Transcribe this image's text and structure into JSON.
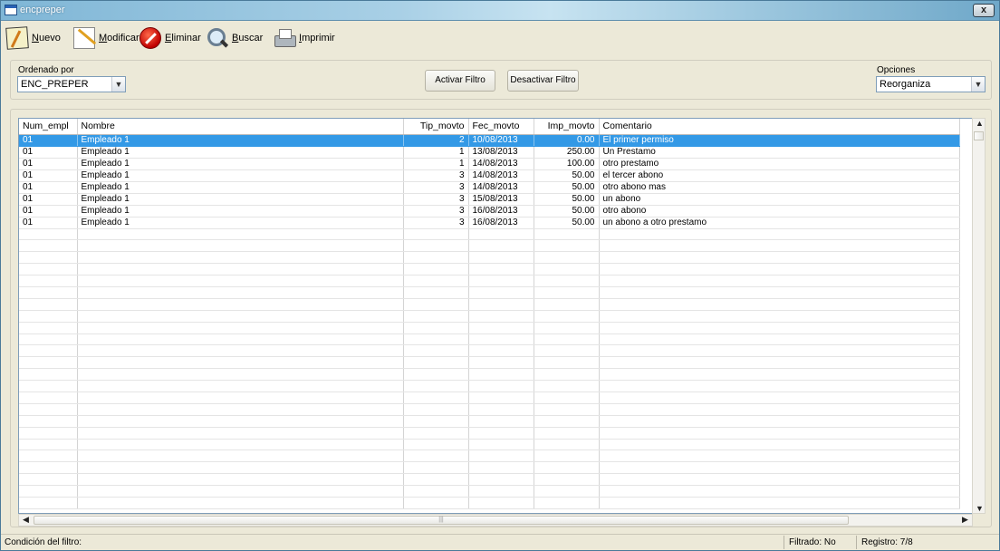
{
  "window": {
    "title": "encpreper",
    "close_label": "x"
  },
  "toolbar": {
    "new_label": "Nuevo",
    "edit_label": "Modificar",
    "delete_label": "Eliminar",
    "search_label": "Buscar",
    "print_label": "Imprimir"
  },
  "filter": {
    "order_label": "Ordenado por",
    "order_value": "ENC_PREPER",
    "activate_label": "Activar Filtro",
    "deactivate_label": "Desactivar Filtro",
    "options_label": "Opciones",
    "options_value": "Reorganiza"
  },
  "grid": {
    "columns": [
      "Num_empl",
      "Nombre",
      "Tip_movto",
      "Fec_movto",
      "Imp_movto",
      "Comentario"
    ],
    "rows": [
      [
        "01",
        "Empleado 1",
        "2",
        "10/08/2013",
        "0.00",
        "El primer permiso"
      ],
      [
        "01",
        "Empleado 1",
        "1",
        "13/08/2013",
        "250.00",
        "Un Prestamo"
      ],
      [
        "01",
        "Empleado 1",
        "1",
        "14/08/2013",
        "100.00",
        "otro prestamo"
      ],
      [
        "01",
        "Empleado 1",
        "3",
        "14/08/2013",
        "50.00",
        "el tercer abono"
      ],
      [
        "01",
        "Empleado 1",
        "3",
        "14/08/2013",
        "50.00",
        "otro abono mas"
      ],
      [
        "01",
        "Empleado 1",
        "3",
        "15/08/2013",
        "50.00",
        "un abono"
      ],
      [
        "01",
        "Empleado 1",
        "3",
        "16/08/2013",
        "50.00",
        "otro abono"
      ],
      [
        "01",
        "Empleado 1",
        "3",
        "16/08/2013",
        "50.00",
        "un abono a otro prestamo"
      ]
    ],
    "selected_row": 0,
    "selection_color": "#3399e6"
  },
  "status": {
    "filter_condition": "Condición del filtro:",
    "filtered": "Filtrado: No",
    "record": "Registro: 7/8"
  }
}
